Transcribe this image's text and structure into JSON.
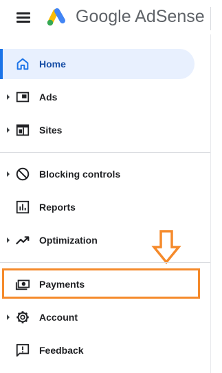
{
  "header": {
    "brand": "Google AdSense",
    "menu_icon": "hamburger-menu-icon",
    "logo_icon": "adsense-logo-icon",
    "logo_colors": [
      "#fbbc04",
      "#4285f4",
      "#34a853"
    ]
  },
  "nav": {
    "items": [
      {
        "label": "Home",
        "icon": "home-icon",
        "active": true,
        "expandable": false
      },
      {
        "label": "Ads",
        "icon": "ads-icon",
        "active": false,
        "expandable": true
      },
      {
        "label": "Sites",
        "icon": "sites-icon",
        "active": false,
        "expandable": true
      },
      {
        "label": "Blocking controls",
        "icon": "block-icon",
        "active": false,
        "expandable": true
      },
      {
        "label": "Reports",
        "icon": "reports-icon",
        "active": false,
        "expandable": false
      },
      {
        "label": "Optimization",
        "icon": "trending-up-icon",
        "active": false,
        "expandable": true
      },
      {
        "label": "Payments",
        "icon": "payments-icon",
        "active": false,
        "expandable": false
      },
      {
        "label": "Account",
        "icon": "gear-icon",
        "active": false,
        "expandable": true
      },
      {
        "label": "Feedback",
        "icon": "feedback-icon",
        "active": false,
        "expandable": false
      }
    ]
  },
  "annotation": {
    "highlight_color": "#f58a2b",
    "arrow_icon": "down-arrow-icon"
  },
  "colors": {
    "active_bg": "#e8f0fe",
    "active_accent": "#1a73e8",
    "active_text": "#174ea6"
  }
}
